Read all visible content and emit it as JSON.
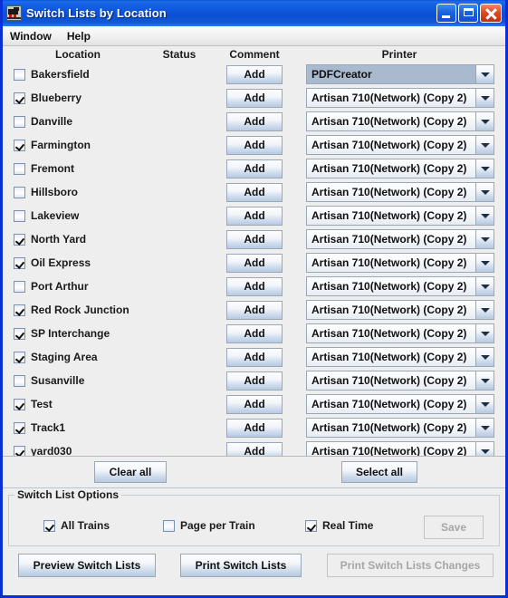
{
  "window": {
    "title": "Switch Lists by Location",
    "icon": "locomotive-icon",
    "minimize_label": "",
    "maximize_label": "",
    "close_label": "",
    "border_color": "#0a2fd4",
    "titlebar_color": "#0d55da"
  },
  "menubar": {
    "items": [
      {
        "label": "Window"
      },
      {
        "label": "Help"
      }
    ]
  },
  "table": {
    "headers": {
      "location": "Location",
      "status": "Status",
      "comment": "Comment",
      "printer": "Printer"
    },
    "add_label": "Add",
    "rows": [
      {
        "location": "Bakersfield",
        "checked": false,
        "status": "",
        "comment_button": "Add",
        "printer": "PDFCreator",
        "printer_selected": true
      },
      {
        "location": "Blueberry",
        "checked": true,
        "status": "",
        "comment_button": "Add",
        "printer": "Artisan 710(Network) (Copy 2)",
        "printer_selected": false
      },
      {
        "location": "Danville",
        "checked": false,
        "status": "",
        "comment_button": "Add",
        "printer": "Artisan 710(Network) (Copy 2)",
        "printer_selected": false
      },
      {
        "location": "Farmington",
        "checked": true,
        "status": "",
        "comment_button": "Add",
        "printer": "Artisan 710(Network) (Copy 2)",
        "printer_selected": false
      },
      {
        "location": "Fremont",
        "checked": false,
        "status": "",
        "comment_button": "Add",
        "printer": "Artisan 710(Network) (Copy 2)",
        "printer_selected": false
      },
      {
        "location": "Hillsboro",
        "checked": false,
        "status": "",
        "comment_button": "Add",
        "printer": "Artisan 710(Network) (Copy 2)",
        "printer_selected": false
      },
      {
        "location": "Lakeview",
        "checked": false,
        "status": "",
        "comment_button": "Add",
        "printer": "Artisan 710(Network) (Copy 2)",
        "printer_selected": false
      },
      {
        "location": "North Yard",
        "checked": true,
        "status": "",
        "comment_button": "Add",
        "printer": "Artisan 710(Network) (Copy 2)",
        "printer_selected": false
      },
      {
        "location": "Oil Express",
        "checked": true,
        "status": "",
        "comment_button": "Add",
        "printer": "Artisan 710(Network) (Copy 2)",
        "printer_selected": false
      },
      {
        "location": "Port Arthur",
        "checked": false,
        "status": "",
        "comment_button": "Add",
        "printer": "Artisan 710(Network) (Copy 2)",
        "printer_selected": false
      },
      {
        "location": "Red Rock Junction",
        "checked": true,
        "status": "",
        "comment_button": "Add",
        "printer": "Artisan 710(Network) (Copy 2)",
        "printer_selected": false
      },
      {
        "location": "SP Interchange",
        "checked": true,
        "status": "",
        "comment_button": "Add",
        "printer": "Artisan 710(Network) (Copy 2)",
        "printer_selected": false
      },
      {
        "location": "Staging Area",
        "checked": true,
        "status": "",
        "comment_button": "Add",
        "printer": "Artisan 710(Network) (Copy 2)",
        "printer_selected": false
      },
      {
        "location": "Susanville",
        "checked": false,
        "status": "",
        "comment_button": "Add",
        "printer": "Artisan 710(Network) (Copy 2)",
        "printer_selected": false
      },
      {
        "location": "Test",
        "checked": true,
        "status": "",
        "comment_button": "Add",
        "printer": "Artisan 710(Network) (Copy 2)",
        "printer_selected": false
      },
      {
        "location": "Track1",
        "checked": true,
        "status": "",
        "comment_button": "Add",
        "printer": "Artisan 710(Network) (Copy 2)",
        "printer_selected": false
      },
      {
        "location": "yard030",
        "checked": true,
        "status": "",
        "comment_button": "Add",
        "printer": "Artisan 710(Network) (Copy 2)",
        "printer_selected": false
      }
    ]
  },
  "actions": {
    "clear_all": "Clear all",
    "select_all": "Select all"
  },
  "options": {
    "group_title": "Switch List Options",
    "all_trains": {
      "label": "All Trains",
      "checked": true
    },
    "page_per_train": {
      "label": "Page per Train",
      "checked": false
    },
    "real_time": {
      "label": "Real Time",
      "checked": true
    },
    "save": {
      "label": "Save",
      "enabled": false
    }
  },
  "bottom": {
    "preview": {
      "label": "Preview Switch Lists",
      "enabled": true
    },
    "print": {
      "label": "Print Switch Lists",
      "enabled": true
    },
    "print_changes": {
      "label": "Print Switch Lists Changes",
      "enabled": false
    }
  }
}
